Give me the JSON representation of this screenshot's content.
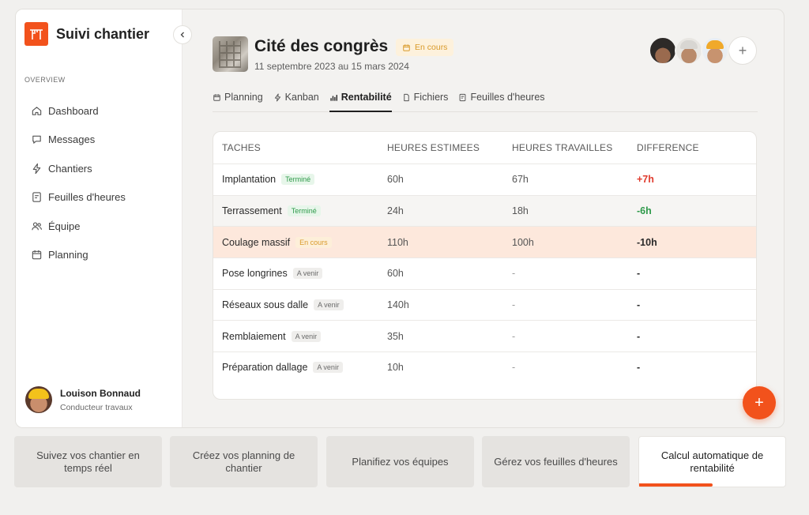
{
  "app": {
    "name": "Suivi chantier"
  },
  "sidebar": {
    "section": "OVERVIEW",
    "items": [
      {
        "label": "Dashboard",
        "icon": "home-icon"
      },
      {
        "label": "Messages",
        "icon": "chat-icon"
      },
      {
        "label": "Chantiers",
        "icon": "bolt-icon"
      },
      {
        "label": "Feuilles d'heures",
        "icon": "timesheet-icon"
      },
      {
        "label": "Équipe",
        "icon": "team-icon"
      },
      {
        "label": "Planning",
        "icon": "calendar-icon"
      }
    ],
    "user": {
      "name": "Louison Bonnaud",
      "role": "Conducteur travaux"
    }
  },
  "project": {
    "title": "Cité des congrès",
    "status": "En cours",
    "dates": "11 septembre 2023 au 15 mars 2024",
    "add_member": "+"
  },
  "tabs": [
    {
      "label": "Planning",
      "icon": "calendar-icon",
      "active": false
    },
    {
      "label": "Kanban",
      "icon": "bolt-icon",
      "active": false
    },
    {
      "label": "Rentabilité",
      "icon": "bar-chart-icon",
      "active": true
    },
    {
      "label": "Fichiers",
      "icon": "file-icon",
      "active": false
    },
    {
      "label": "Feuilles d'heures",
      "icon": "timesheet-icon",
      "active": false
    }
  ],
  "table": {
    "headers": [
      "TACHES",
      "HEURES ESTIMEES",
      "HEURES TRAVAILLES",
      "DIFFERENCE"
    ],
    "rows": [
      {
        "task": "Implantation",
        "badge": "Terminé",
        "estimated": "60h",
        "worked": "67h",
        "diff": "+7h"
      },
      {
        "task": "Terrassement",
        "badge": "Terminé",
        "estimated": "24h",
        "worked": "18h",
        "diff": "-6h"
      },
      {
        "task": "Coulage massif",
        "badge": "En cours",
        "estimated": "110h",
        "worked": "100h",
        "diff": "-10h"
      },
      {
        "task": "Pose longrines",
        "badge": "A venir",
        "estimated": "60h",
        "worked": "-",
        "diff": "-"
      },
      {
        "task": "Réseaux sous dalle",
        "badge": "A venir",
        "estimated": "140h",
        "worked": "-",
        "diff": "-"
      },
      {
        "task": "Remblaiement",
        "badge": "A venir",
        "estimated": "35h",
        "worked": "-",
        "diff": "-"
      },
      {
        "task": "Préparation dallage",
        "badge": "A venir",
        "estimated": "10h",
        "worked": "-",
        "diff": "-"
      }
    ]
  },
  "fab": {
    "label": "+"
  },
  "features": [
    {
      "label": "Suivez vos chantier en temps réel",
      "active": false
    },
    {
      "label": "Créez vos planning de chantier",
      "active": false
    },
    {
      "label": "Planifiez vos équipes",
      "active": false
    },
    {
      "label": "Gérez vos feuilles d'heures",
      "active": false
    },
    {
      "label": "Calcul automatique de rentabilité",
      "active": true,
      "progress": 0.5
    }
  ],
  "colors": {
    "accent": "#f2521c",
    "positive": "#e03b2d",
    "negative": "#2f9a4b",
    "highlight_row": "#fde8dc"
  }
}
